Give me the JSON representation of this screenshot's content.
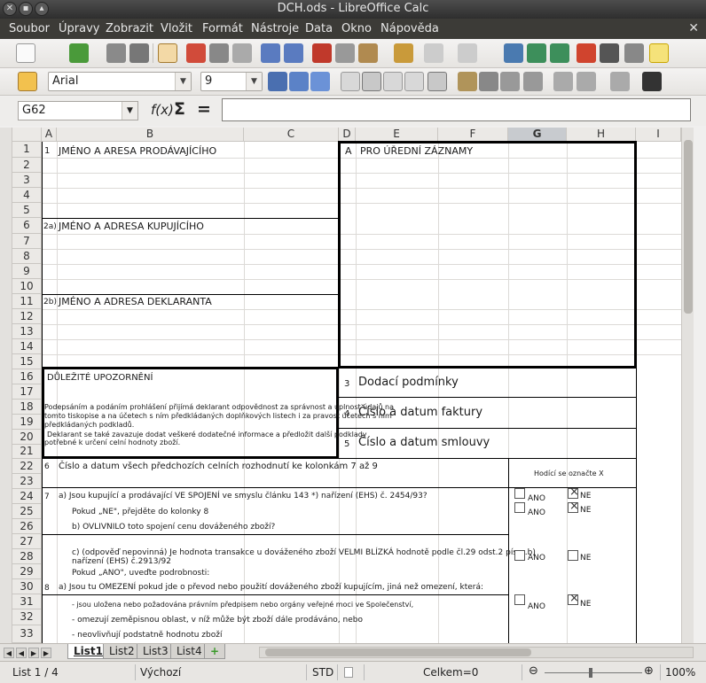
{
  "window": {
    "title": "DCH.ods - LibreOffice Calc"
  },
  "menu": [
    "Soubor",
    "Úpravy",
    "Zobrazit",
    "Vložit",
    "Formát",
    "Nástroje",
    "Data",
    "Okno",
    "Nápověda"
  ],
  "format_toolbar": {
    "font_name": "Arial",
    "font_size": "9"
  },
  "formula_bar": {
    "cell_ref": "G62",
    "value": ""
  },
  "columns": [
    "A",
    "B",
    "C",
    "D",
    "E",
    "F",
    "G",
    "H",
    "I"
  ],
  "selected_column": "G",
  "rows": [
    "1",
    "2",
    "3",
    "4",
    "5",
    "6",
    "7",
    "8",
    "9",
    "10",
    "11",
    "12",
    "13",
    "14",
    "15",
    "16",
    "17",
    "18",
    "19",
    "20",
    "21",
    "22",
    "23",
    "24",
    "25",
    "26",
    "27",
    "28",
    "29",
    "30",
    "31",
    "32",
    "33"
  ],
  "cells": {
    "r1_num": "1",
    "r1_label": "JMÉNO A ARESA PRODÁVAJÍCÍHO",
    "a_num": "A",
    "a_label": "PRO ÚŘEDNÍ ZÁZNAMY",
    "r6_num": "2a)",
    "r6_label": "JMÉNO A ADRESA KUPUJÍCÍHO",
    "r11_num": "2b)",
    "r11_label": "JMÉNO A ADRESA DEKLARANTA",
    "notice_title": "DŮLEŽITÉ UPOZORNĚNÍ",
    "notice_line1": "Podepsáním a podáním prohlášení přijímá deklarant odpovědnost za správnost a úplnost údajů na",
    "notice_line2": "tomto tiskopise a na účetech s ním předkládaných doplňkových listech i za pravost účetech s ním",
    "notice_line3": "předkládaných podkladů.",
    "notice_line4": "Deklarant se také zavazuje dodat veškeré dodatečné informace a předložit další podklady",
    "notice_line5": "potřebné k určení celní hodnoty zboží.",
    "r3_num": "3",
    "r3_label": "Dodací podmínky",
    "r4_num": "4",
    "r4_label": "Číslo a datum faktury",
    "r5_num": "5",
    "r5_label": "Číslo a datum smlouvy",
    "r22_num": "6",
    "r22_label": "Číslo a datum všech předchozích celních rozhodnutí ke kolonkám 7 až 9",
    "hint_x": "Hodící se označte X",
    "r24_num": "7",
    "r24_label": "a) Jsou kupující a prodávající VE SPOJENÍ ve smyslu článku 143 *) nařízení (EHS) č. 2454/93?",
    "r25_label": "Pokud „NE\", přejděte do kolonky 8",
    "r26_label": "b) OVLIVNILO toto spojení cenu dováženého zboží?",
    "r28_label1": "c) (odpověď nepovinná) Je hodnota transakce u dováženého zboží VELMI BLÍZKÁ hodnotě podle čl.29 odst.2 písm.b)",
    "r28_label2": "nařízení (EHS) č.2913/92",
    "r29_label": "Pokud „ANO\", uveďte podrobnosti:",
    "r30_num": "8",
    "r30_label": "a) Jsou tu OMEZENÍ pokud jde o převod nebo použití dováženého zboží kupujícím, jiná než omezení, která:",
    "r31_label": "- jsou uložena nebo požadována právním předpisem nebo orgány veřejné moci ve Společenství,",
    "r32_label": "- omezují zeměpisnou oblast, v níž může být zboží dále prodáváno, nebo",
    "r33_label": "- neovlivňují podstatně hodnotu zboží",
    "ano": "ANO",
    "ne": "NE"
  },
  "sheet_tabs": [
    "List1",
    "List2",
    "List3",
    "List4"
  ],
  "active_tab": "List1",
  "status": {
    "sheet": "List 1 / 4",
    "style": "Výchozí",
    "mode": "STD",
    "sum": "Celkem=0",
    "zoom": "100%"
  }
}
